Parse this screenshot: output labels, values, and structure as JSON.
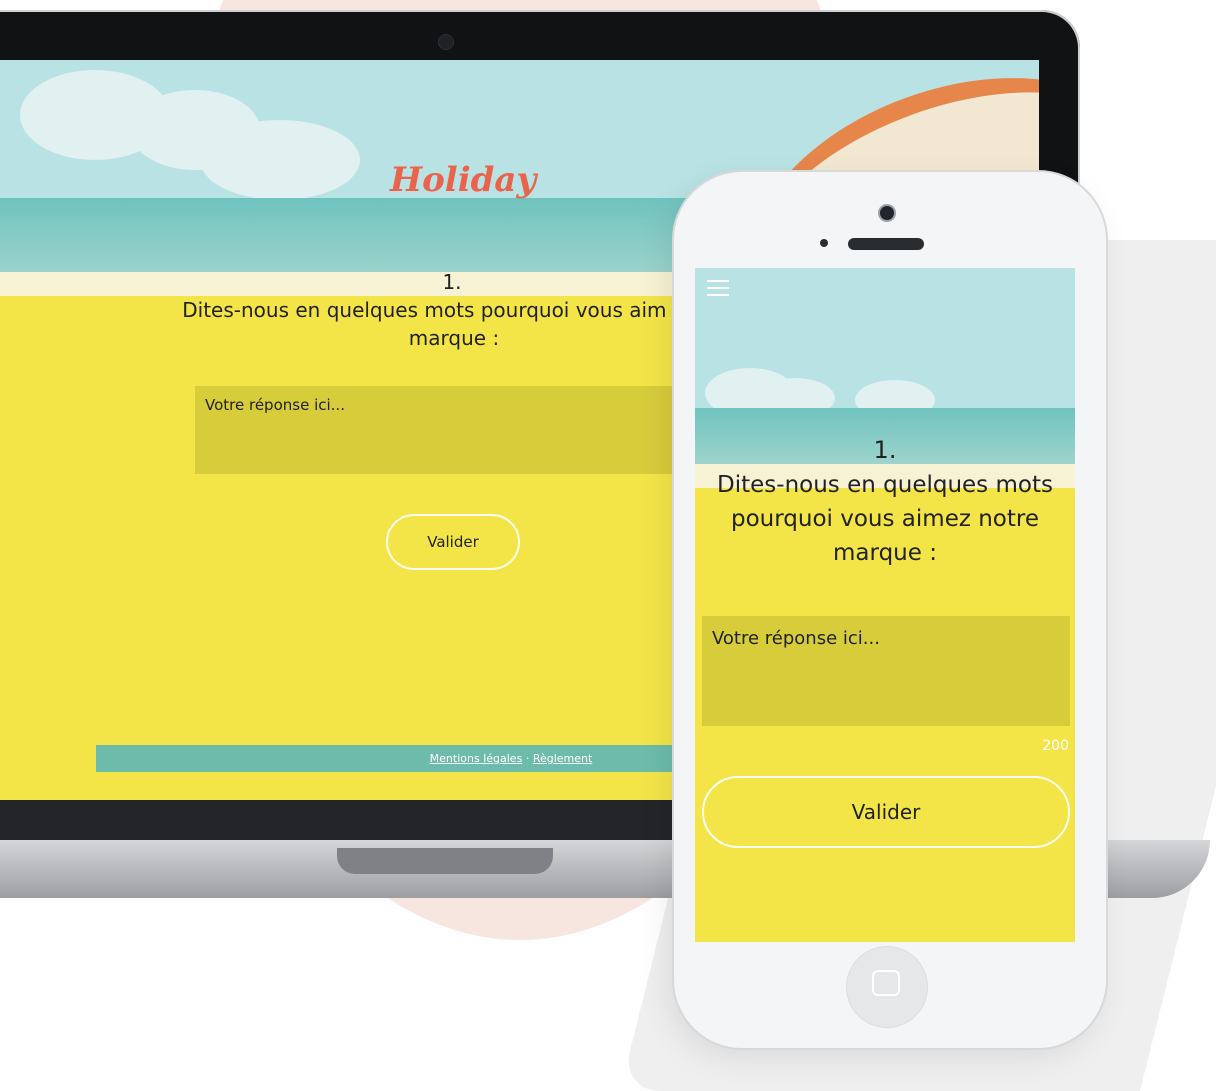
{
  "brand": {
    "logo_text": "Holiday"
  },
  "laptop": {
    "question_number": "1.",
    "question_text": "Dites-nous en quelques mots pourquoi vous aim notre marque :",
    "answer_placeholder": "Votre réponse ici...",
    "submit_label": "Valider",
    "footer": {
      "legal_label": "Mentions légales",
      "separator": "·",
      "rules_label": "Règlement"
    }
  },
  "phone": {
    "question_number": "1.",
    "question_text": "Dites-nous en quelques mots pourquoi vous aimez notre marque :",
    "answer_placeholder": "Votre réponse ici...",
    "char_counter": "200",
    "submit_label": "Valider",
    "menu_icon": "hamburger-menu-icon",
    "home_icon": "home-button-icon"
  },
  "colors": {
    "sand": "#f3e548",
    "sky": "#b9e2e4",
    "sea": "#6fc3be",
    "footer": "#6dbcab",
    "logo": "#e9644a",
    "textarea": "#d7cc3a"
  }
}
